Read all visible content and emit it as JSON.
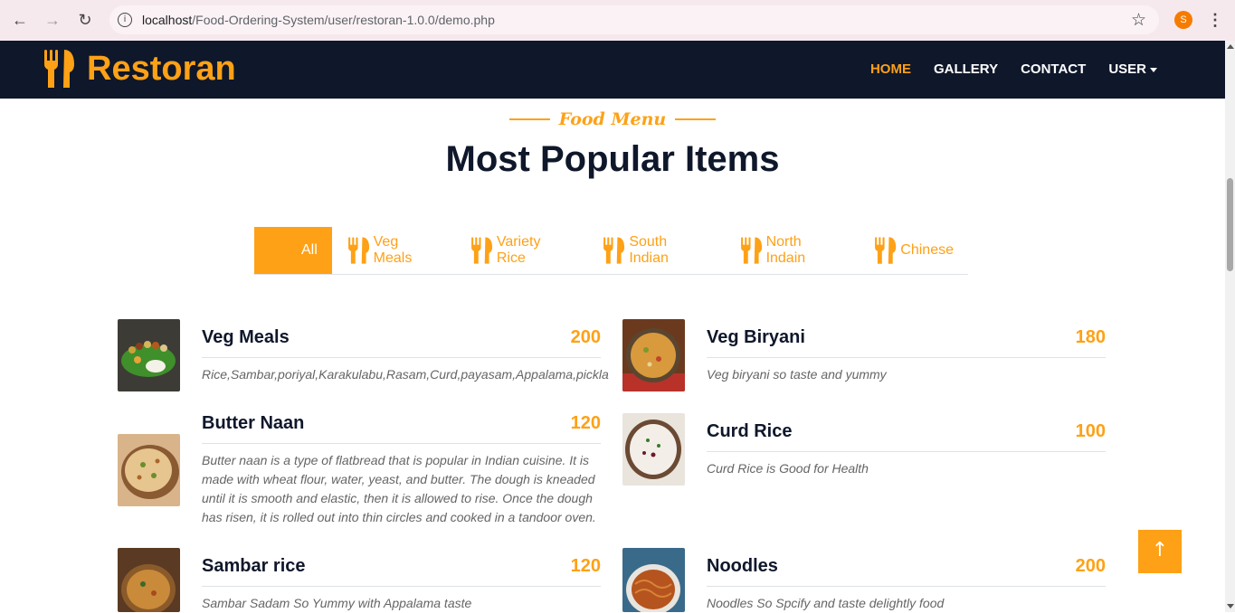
{
  "browser": {
    "url_host": "localhost",
    "url_path": "/Food-Ordering-System/user/restoran-1.0.0/demo.php",
    "profile_initial": "S"
  },
  "navbar": {
    "brand": "Restoran",
    "links": [
      "HOME",
      "GALLERY",
      "CONTACT",
      "USER"
    ]
  },
  "section": {
    "subtitle": "Food Menu",
    "title": "Most Popular Items"
  },
  "tabs": [
    "All",
    "Veg Meals",
    "Variety Rice",
    "South Indian",
    "North Indain",
    "Chinese"
  ],
  "items": [
    {
      "name": "Veg Meals",
      "price": "200",
      "desc": "Rice,Sambar,poriyal,Karakulabu,Rasam,Curd,payasam,Appalama,pickla"
    },
    {
      "name": "Veg Biryani",
      "price": "180",
      "desc": "Veg biryani so taste and yummy"
    },
    {
      "name": "Butter Naan",
      "price": "120",
      "desc": "Butter naan is a type of flatbread that is popular in Indian cuisine. It is made with wheat flour, water, yeast, and butter. The dough is kneaded until it is smooth and elastic, then it is allowed to rise. Once the dough has risen, it is rolled out into thin circles and cooked in a tandoor oven."
    },
    {
      "name": "Curd Rice",
      "price": "100",
      "desc": "Curd Rice is Good for Health"
    },
    {
      "name": "Sambar rice",
      "price": "120",
      "desc": "Sambar Sadam So Yummy with Appalama taste"
    },
    {
      "name": "Noodles",
      "price": "200",
      "desc": "Noodles So Spcify and taste delightly food"
    }
  ],
  "colors": {
    "accent": "#fea116",
    "dark": "#0f172b"
  }
}
